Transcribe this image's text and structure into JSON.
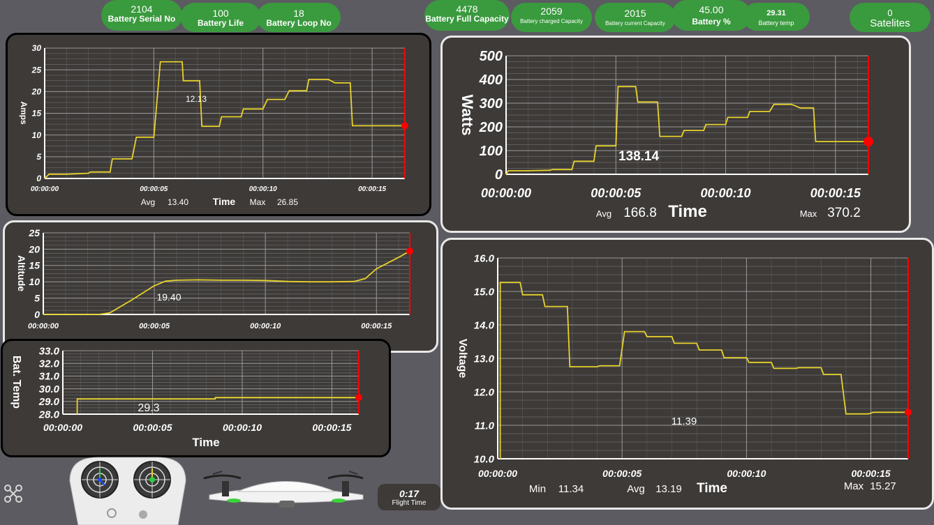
{
  "top_bar": [
    {
      "value": "2104",
      "label": "Battery Serial No"
    },
    {
      "value": "100",
      "label": "Battery Life"
    },
    {
      "value": "18",
      "label": "Battery Loop No"
    },
    {
      "value": "4478",
      "label": "Battery Full Capacity"
    },
    {
      "value": "2059",
      "label": "Battery charged Capacity"
    },
    {
      "value": "2015",
      "label": "Battery current Capacity"
    },
    {
      "value": "45.00",
      "label": "Battery %"
    },
    {
      "value": "29.31",
      "label": "Battery temp"
    },
    {
      "value": "0",
      "label": "Satelites"
    }
  ],
  "flight": {
    "value": "0:17",
    "label": "Flight Time"
  },
  "colors": {
    "line": "#e8d22b",
    "cursor": "#ff0000",
    "grid": "#8a8a8a",
    "panel": "#3d3a38",
    "pill": "#3a9a3e",
    "background": "#5c5b61"
  },
  "icons": [
    "drone-logo-icon",
    "remote-controller-icon",
    "quadcopter-icon"
  ],
  "chart_data": [
    {
      "id": "amps",
      "type": "line",
      "ylabel": "Amps",
      "xlabel": "Time",
      "yticks": [
        "0",
        "5",
        "10",
        "15",
        "20",
        "25",
        "30"
      ],
      "ylim": [
        0,
        30
      ],
      "xticks": [
        "00:00:00",
        "00:00:05",
        "00:00:10",
        "00:00:15"
      ],
      "xlim": [
        0,
        16.5
      ],
      "current_label": "12.13",
      "stats": {
        "avg_label": "Avg",
        "avg": "13.40",
        "max_label": "Max",
        "max": "26.85"
      },
      "x": [
        0,
        0.2,
        1,
        2,
        2.1,
        3,
        3.1,
        4,
        4.2,
        5,
        5.3,
        5.35,
        6.3,
        6.35,
        7.1,
        7.2,
        8,
        8.1,
        9,
        9.1,
        10,
        10.2,
        11,
        11.2,
        12,
        12.1,
        13,
        13.3,
        13.35,
        14,
        14.1,
        15,
        16.5
      ],
      "y": [
        0,
        1,
        1,
        1.2,
        1.5,
        1.5,
        4.5,
        4.5,
        9.5,
        9.5,
        26.85,
        26.85,
        26.85,
        22.5,
        22.5,
        12,
        12,
        14.2,
        14.2,
        16,
        16,
        18.2,
        18.2,
        20.2,
        20.2,
        22.8,
        22.8,
        22,
        22,
        22,
        12.13,
        12.13,
        12.13
      ]
    },
    {
      "id": "watts",
      "type": "line",
      "ylabel": "Watts",
      "xlabel": "Time",
      "yticks": [
        "0",
        "100",
        "200",
        "300",
        "400",
        "500"
      ],
      "ylim": [
        0,
        500
      ],
      "xticks": [
        "00:00:00",
        "00:00:05",
        "00:00:10",
        "00:00:15"
      ],
      "xlim": [
        0,
        16.5
      ],
      "current_label": "138.14",
      "stats": {
        "avg_label": "Avg",
        "avg": "166.8",
        "max_label": "Max",
        "max": "370.2"
      },
      "x": [
        0,
        0.1,
        1,
        2,
        2.1,
        3,
        3.1,
        4,
        4.1,
        5,
        5.1,
        5.9,
        6,
        6.9,
        7,
        8,
        8.1,
        9,
        9.1,
        10,
        10.1,
        11,
        11.1,
        12,
        12.2,
        13,
        13.4,
        14,
        14.1,
        16.5
      ],
      "y": [
        0,
        15,
        15,
        17,
        20,
        20,
        55,
        55,
        120,
        120,
        370,
        370,
        305,
        305,
        160,
        160,
        185,
        185,
        210,
        210,
        240,
        240,
        265,
        265,
        295,
        295,
        280,
        280,
        138.14,
        138.14
      ]
    },
    {
      "id": "altitude",
      "type": "line",
      "ylabel": "Altitude",
      "xlabel": "Time",
      "yticks": [
        "0",
        "5",
        "10",
        "15",
        "20",
        "25"
      ],
      "ylim": [
        0,
        25
      ],
      "xticks": [
        "00:00:00",
        "00:00:05",
        "00:00:10",
        "00:00:15"
      ],
      "xlim": [
        0,
        16.5
      ],
      "current_label": "19.40",
      "x": [
        0,
        2.5,
        3,
        4,
        5,
        5.5,
        6,
        7,
        8,
        9,
        10,
        11,
        12,
        13,
        14,
        14.5,
        15,
        16,
        16.5
      ],
      "y": [
        0,
        0,
        0.5,
        4.5,
        8.8,
        10.2,
        10.5,
        10.6,
        10.5,
        10.5,
        10.4,
        10.1,
        10,
        10,
        10.1,
        11,
        14,
        17.5,
        19.4
      ]
    },
    {
      "id": "bat_temp",
      "type": "line",
      "ylabel": "Bat. Temp",
      "xlabel": "Time",
      "yticks": [
        "28.0",
        "29.0",
        "30.0",
        "31.0",
        "32.0",
        "33.0"
      ],
      "ylim": [
        28,
        33
      ],
      "xticks": [
        "00:00:00",
        "00:00:05",
        "00:00:10",
        "00:00:15"
      ],
      "xlim": [
        0,
        16.5
      ],
      "current_label": "29.3",
      "x": [
        0.8,
        0.8,
        8.5,
        8.5,
        16.5
      ],
      "y": [
        28,
        29.2,
        29.2,
        29.31,
        29.31
      ]
    },
    {
      "id": "voltage",
      "type": "line",
      "ylabel": "Voltage",
      "xlabel": "Time",
      "yticks": [
        "10.0",
        "11.0",
        "12.0",
        "13.0",
        "14.0",
        "15.0",
        "16.0"
      ],
      "ylim": [
        10,
        16
      ],
      "xticks": [
        "00:00:00",
        "00:00:05",
        "00:00:10",
        "00:00:15"
      ],
      "xlim": [
        0,
        16.5
      ],
      "current_label": "11.39",
      "stats": {
        "min_label": "Min",
        "min": "11.34",
        "avg_label": "Avg",
        "avg": "13.19",
        "max_label": "Max",
        "max": "15.27"
      },
      "x": [
        0.1,
        0.1,
        0.9,
        1,
        1.8,
        1.9,
        2.8,
        2.9,
        4,
        4.1,
        4.9,
        5.1,
        5.9,
        6,
        7,
        7.1,
        8,
        8.1,
        9,
        9.1,
        10,
        10.1,
        11,
        11.1,
        12,
        12.1,
        13,
        13.1,
        13.8,
        14,
        14.9,
        15.1,
        16.5
      ],
      "y": [
        10,
        15.27,
        15.27,
        14.9,
        14.9,
        14.55,
        14.55,
        12.75,
        12.75,
        12.78,
        12.78,
        13.8,
        13.8,
        13.65,
        13.65,
        13.45,
        13.45,
        13.25,
        13.25,
        13.02,
        13.02,
        12.88,
        12.88,
        12.7,
        12.7,
        12.72,
        12.72,
        12.52,
        12.52,
        11.34,
        11.34,
        11.39,
        11.39
      ]
    }
  ]
}
